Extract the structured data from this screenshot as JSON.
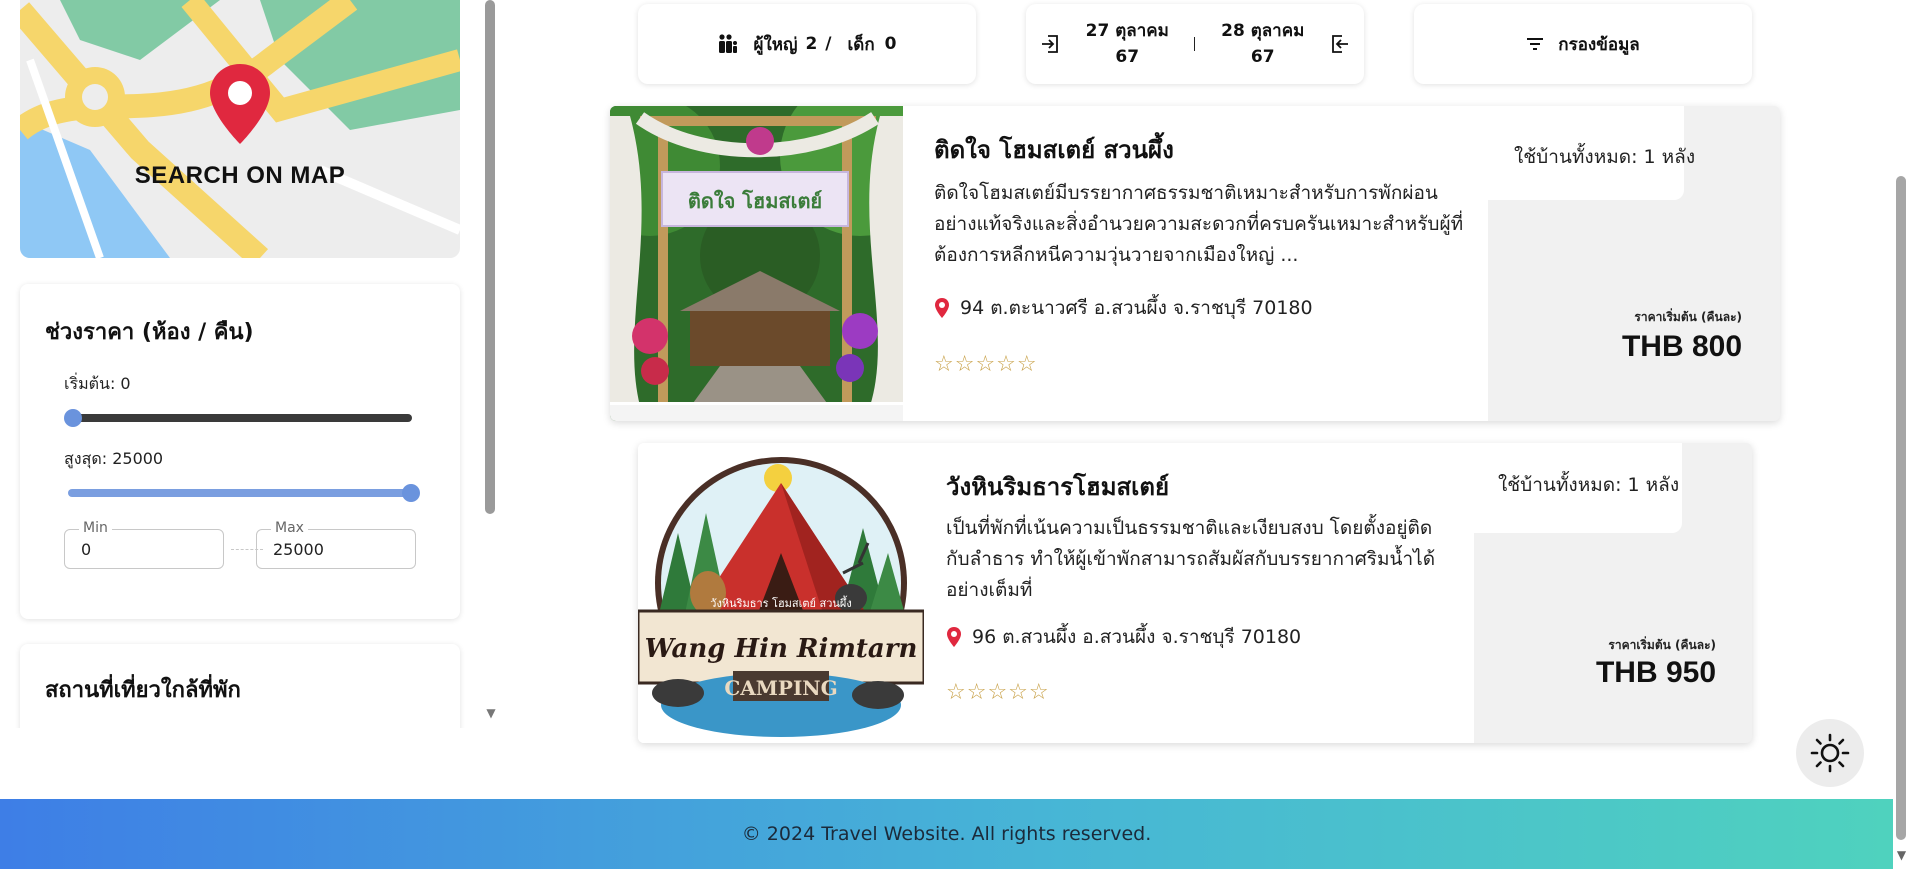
{
  "sidebar": {
    "map_button": {
      "label": "SEARCH ON MAP",
      "icon": "map-pin-icon"
    },
    "price_filter": {
      "title": "ช่วงราคา (ห้อง / คืน)",
      "start_label": "เริ่มต้น: 0",
      "max_label": "สูงสุด: 25000",
      "min_fraction": 0,
      "max_fraction": 1,
      "min_field": {
        "legend": "Min",
        "value": "0"
      },
      "max_field": {
        "legend": "Max",
        "value": "25000"
      }
    },
    "nearby": {
      "title": "สถานที่เที่ยวใกล้ที่พัก"
    }
  },
  "search_bar": {
    "guests": {
      "icon": "people-icon",
      "adults_label": "ผู้ใหญ่",
      "adults": "2",
      "separator": "/",
      "children_label": "เด็ก",
      "children": "0"
    },
    "dates": {
      "checkin_icon": "check-in-icon",
      "checkin_day": "27 ตุลาคม",
      "checkin_year": "67",
      "checkout_day": "28 ตุลาคม",
      "checkout_year": "67",
      "checkout_icon": "check-out-icon"
    },
    "filter": {
      "icon": "filter-icon",
      "label": "กรองข้อมูล"
    }
  },
  "listings": [
    {
      "name": "ติดใจ โฮมสเตย์ สวนผึ้ง",
      "description": "ติดใจโฮมสเตย์มีบรรยากาศธรรมชาติเหมาะสำหรับการพักผ่อนอย่างแท้จริงและสิ่งอำนวยความสะดวกที่ครบครันเหมาะสำหรับผู้ที่ต้องการหลีกหนีความวุ่นวายจากเมืองใหญ่ ...",
      "address": "94 ต.ตะนาวศรี อ.สวนผึ้ง จ.ราชบุรี 70180",
      "stars": "☆☆☆☆☆",
      "rating": 0,
      "whole_house": "ใช้บ้านทั้งหมด: 1 หลัง",
      "price_caption": "ราคาเริ่มต้น (คืนละ)",
      "price": "THB 800",
      "image_sign": "ติดใจ โฮมสเตย์"
    },
    {
      "name": "วังหินริมธารโฮมสเตย์",
      "description": "เป็นที่พักที่เน้นความเป็นธรรมชาติและเงียบสงบ โดยตั้งอยู่ติดกับลำธาร ทำให้ผู้เข้าพักสามารถสัมผัสกับบรรยากาศริมน้ำได้อย่างเต็มที่",
      "address": "96 ต.สวนผึ้ง อ.สวนผึ้ง จ.ราชบุรี 70180",
      "stars": "☆☆☆☆☆",
      "rating": 0,
      "whole_house": "ใช้บ้านทั้งหมด: 1 หลัง",
      "price_caption": "ราคาเริ่มต้น (คืนละ)",
      "price": "THB 950",
      "logo_top": "วังหินริมธาร โฮมสเตย์ สวนผึ้ง",
      "logo_main": "Wang Hin Rimtarn",
      "logo_sub": "CAMPING"
    }
  ],
  "theme_toggle": {
    "icon": "sun-icon"
  },
  "footer": {
    "text": "© 2024 Travel Website. All rights reserved."
  },
  "colors": {
    "accent_blue": "#6a93dd",
    "pin_red": "#e0283f",
    "star_gold": "#c9a24a",
    "footer_start": "#3e7ee6",
    "footer_end": "#4fd2be"
  }
}
